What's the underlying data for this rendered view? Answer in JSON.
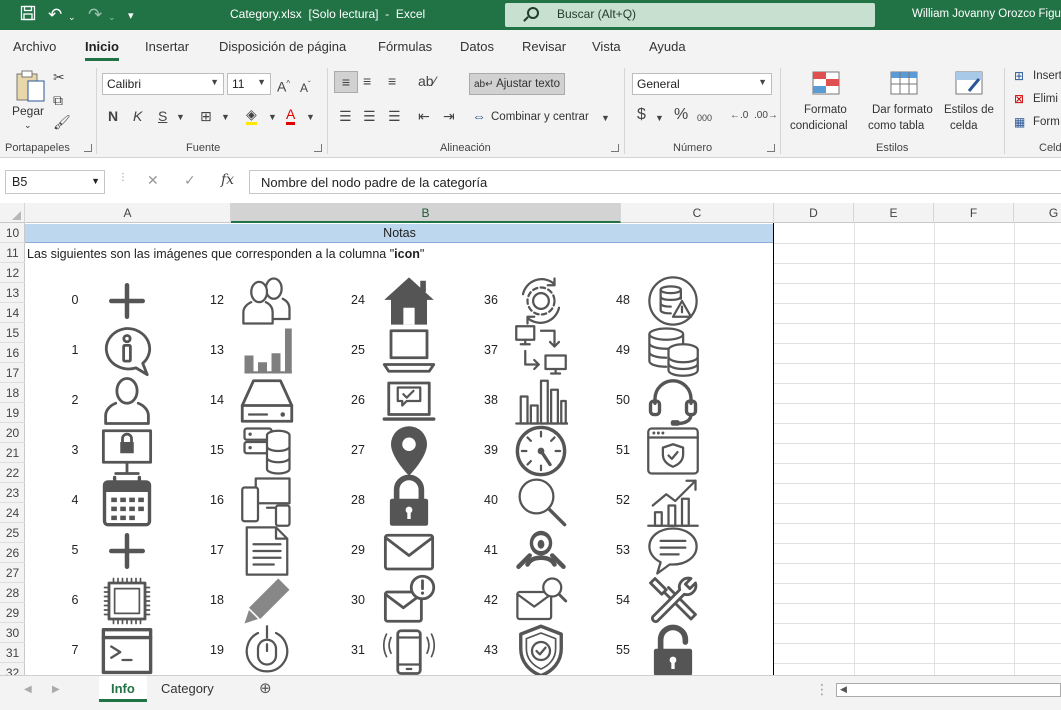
{
  "titlebar": {
    "title": "Category.xlsx  [Solo lectura]  -  Excel",
    "search_placeholder": "Buscar (Alt+Q)",
    "user": "William Jovanny Orozco Figu"
  },
  "tabs": [
    "Archivo",
    "Inicio",
    "Insertar",
    "Disposición de página",
    "Fórmulas",
    "Datos",
    "Revisar",
    "Vista",
    "Ayuda"
  ],
  "active_tab": "Inicio",
  "ribbon": {
    "paste_label": "Pegar",
    "group_clipboard": "Portapapeles",
    "font_name": "Calibri",
    "font_size": "11",
    "group_font": "Fuente",
    "wrap_text": "Ajustar texto",
    "merge_center": "Combinar y centrar",
    "group_alignment": "Alineación",
    "number_format": "General",
    "group_number": "Número",
    "cond_format_1": "Formato",
    "cond_format_2": "condicional",
    "table_format_1": "Dar formato",
    "table_format_2": "como tabla",
    "cell_styles_1": "Estilos de",
    "cell_styles_2": "celda",
    "group_styles": "Estilos",
    "insert": "Insert",
    "delete": "Elimi",
    "format": "Form",
    "group_cells": "Celd",
    "bold": "N",
    "italic": "K",
    "underline": "S"
  },
  "formula_bar": {
    "name_box": "B5",
    "fx": "fx",
    "formula": "Nombre del nodo padre de la categoría"
  },
  "columns": [
    "A",
    "B",
    "C",
    "D",
    "E",
    "F",
    "G"
  ],
  "selected_column": "B",
  "rows": [
    "10",
    "11",
    "12",
    "13",
    "14",
    "15",
    "16",
    "17",
    "18",
    "19",
    "20",
    "21",
    "22",
    "23",
    "24",
    "25",
    "26",
    "27",
    "28",
    "29",
    "30",
    "31",
    "32"
  ],
  "sheet": {
    "notes_header": "Notas",
    "description_prefix": "Las siguientes son las imágenes que corresponden a la columna \"",
    "description_bold": "icon",
    "description_suffix": "\""
  },
  "icons": [
    {
      "n": "0",
      "icon": "plus-icon"
    },
    {
      "n": "1",
      "icon": "info-bubble-icon"
    },
    {
      "n": "2",
      "icon": "user-icon"
    },
    {
      "n": "3",
      "icon": "locked-monitor-icon"
    },
    {
      "n": "4",
      "icon": "calendar-icon"
    },
    {
      "n": "5",
      "icon": "plus-icon"
    },
    {
      "n": "6",
      "icon": "cpu-chip-icon"
    },
    {
      "n": "7",
      "icon": "terminal-icon"
    },
    {
      "n": "12",
      "icon": "users-icon"
    },
    {
      "n": "13",
      "icon": "bar-chart-icon"
    },
    {
      "n": "14",
      "icon": "hard-drive-icon"
    },
    {
      "n": "15",
      "icon": "server-database-icon"
    },
    {
      "n": "16",
      "icon": "devices-icon"
    },
    {
      "n": "17",
      "icon": "document-icon"
    },
    {
      "n": "18",
      "icon": "pencil-icon"
    },
    {
      "n": "19",
      "icon": "mouse-icon"
    },
    {
      "n": "24",
      "icon": "home-icon"
    },
    {
      "n": "25",
      "icon": "laptop-icon"
    },
    {
      "n": "26",
      "icon": "laptop-chat-icon"
    },
    {
      "n": "27",
      "icon": "map-pin-icon"
    },
    {
      "n": "28",
      "icon": "padlock-icon"
    },
    {
      "n": "29",
      "icon": "envelope-icon"
    },
    {
      "n": "30",
      "icon": "mail-alert-icon"
    },
    {
      "n": "31",
      "icon": "phone-ringing-icon"
    },
    {
      "n": "36",
      "icon": "gear-sync-icon"
    },
    {
      "n": "37",
      "icon": "network-monitors-icon"
    },
    {
      "n": "38",
      "icon": "bar-chart-outline-icon"
    },
    {
      "n": "39",
      "icon": "gauge-icon"
    },
    {
      "n": "40",
      "icon": "magnifier-icon"
    },
    {
      "n": "41",
      "icon": "user-search-icon"
    },
    {
      "n": "42",
      "icon": "mail-search-icon"
    },
    {
      "n": "43",
      "icon": "shield-check-icon"
    },
    {
      "n": "48",
      "icon": "database-alert-icon"
    },
    {
      "n": "49",
      "icon": "database-icon"
    },
    {
      "n": "50",
      "icon": "headset-icon"
    },
    {
      "n": "51",
      "icon": "browser-shield-icon"
    },
    {
      "n": "52",
      "icon": "growth-chart-icon"
    },
    {
      "n": "53",
      "icon": "chat-bubble-icon"
    },
    {
      "n": "54",
      "icon": "tools-icon"
    },
    {
      "n": "55",
      "icon": "unlocked-padlock-icon"
    }
  ],
  "sheet_tabs": [
    "Info",
    "Category"
  ],
  "active_sheet": "Info",
  "colors": {
    "accent": "#217346",
    "notes_fill": "#bdd7ee",
    "icon": "#555555"
  }
}
